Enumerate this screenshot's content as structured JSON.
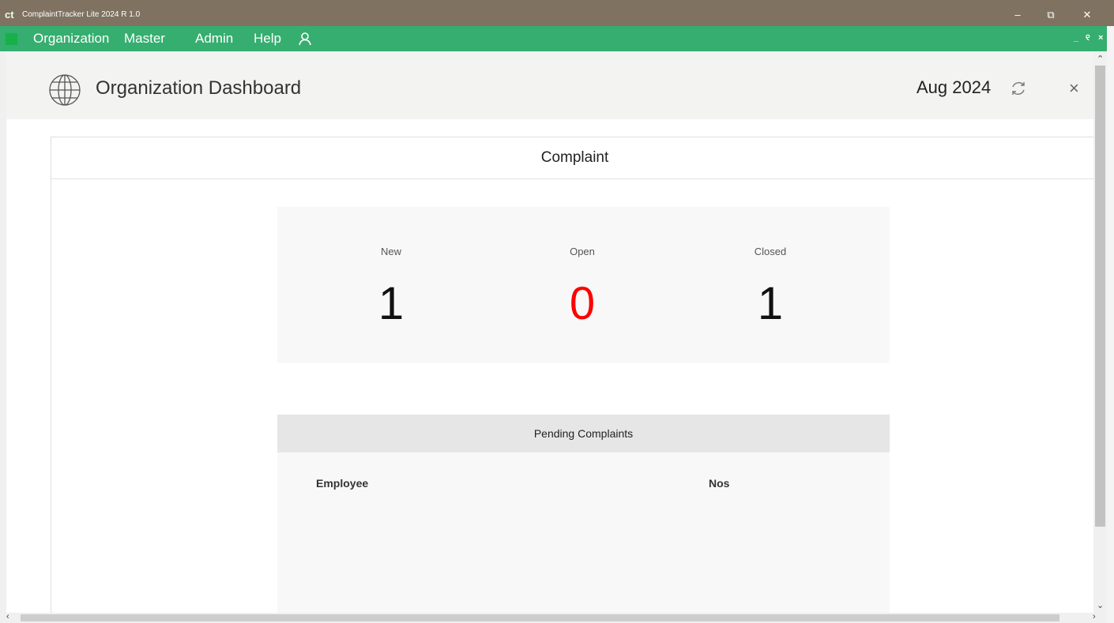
{
  "window": {
    "logo": "ct",
    "title": "ComplaintTracker Lite 2024 R 1.0",
    "minimize": "–",
    "maximize": "⧉",
    "close": "✕"
  },
  "menu": {
    "items": [
      "Organization",
      "Master",
      "Admin",
      "Help"
    ],
    "mdi_minimize": "_",
    "mdi_restore": "୧",
    "mdi_close": "×"
  },
  "header": {
    "title": "Organization Dashboard",
    "period": "Aug 2024",
    "close": "×"
  },
  "complaint": {
    "title": "Complaint",
    "stats": [
      {
        "label": "New",
        "value": "1"
      },
      {
        "label": "Open",
        "value": "0"
      },
      {
        "label": "Closed",
        "value": "1"
      }
    ],
    "open_color": "#ff0000"
  },
  "pending": {
    "title": "Pending Complaints",
    "columns": [
      "Employee",
      "Nos"
    ]
  },
  "colors": {
    "titlebar": "#7f7261",
    "menubar": "#35ae6f",
    "header_bg": "#f3f3f2"
  },
  "icons": {
    "app": "ct-logo-icon",
    "user": "user-icon",
    "page": "globe-icon",
    "refresh": "refresh-icon"
  }
}
